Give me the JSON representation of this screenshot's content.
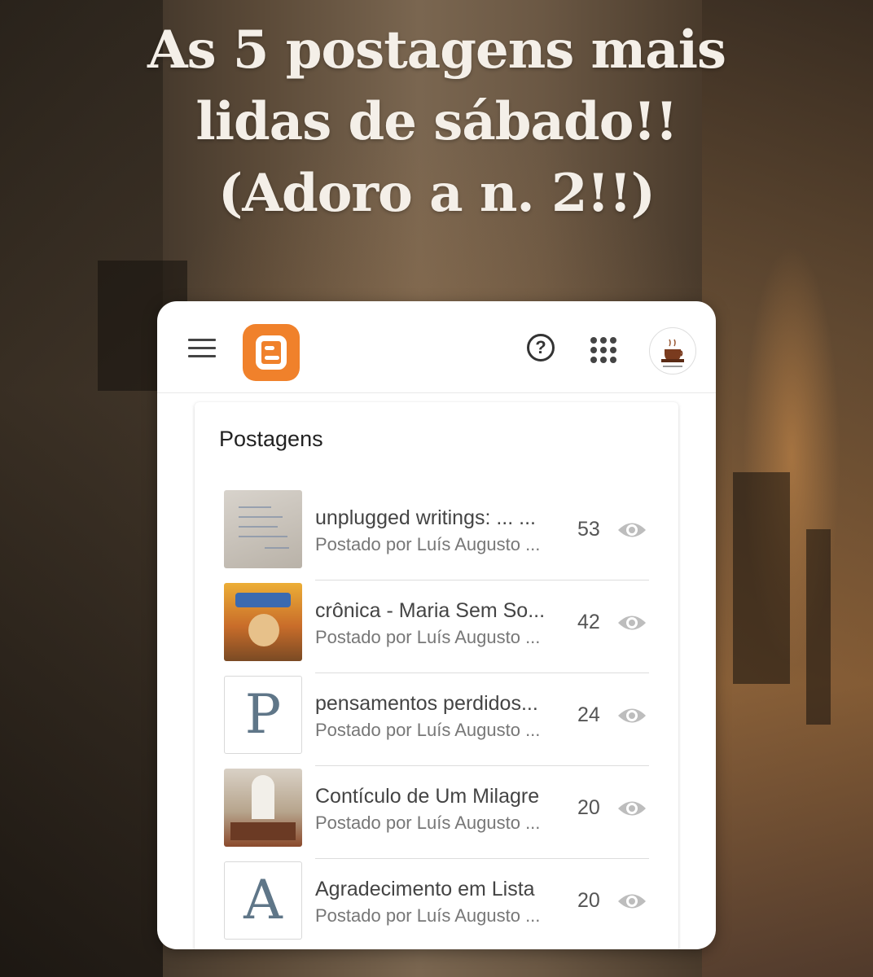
{
  "headline": {
    "line1": "As 5 postagens mais",
    "line2": "lidas de sábado!!",
    "line3": "(Adoro a n. 2!!)"
  },
  "app": {
    "name": "Blogger",
    "brand_color": "#f0812b",
    "help_symbol": "?"
  },
  "panel": {
    "title": "Postagens"
  },
  "posts": [
    {
      "title": "unplugged writings: ... ...",
      "author": "Postado por Luís Augusto ...",
      "views": "53",
      "thumb": "handwritten-note"
    },
    {
      "title": "crônica - Maria Sem So...",
      "author": "Postado por Luís Augusto ...",
      "views": "42",
      "thumb": "comic-cover"
    },
    {
      "title": "pensamentos perdidos...",
      "author": "Postado por Luís Augusto ...",
      "views": "24",
      "thumb_letter": "P"
    },
    {
      "title": "Contículo de Um Milagre",
      "author": "Postado por Luís Augusto ...",
      "views": "20",
      "thumb": "church-interior"
    },
    {
      "title": "Agradecimento em Lista",
      "author": "Postado por Luís Augusto ...",
      "views": "20",
      "thumb_letter": "A"
    }
  ]
}
